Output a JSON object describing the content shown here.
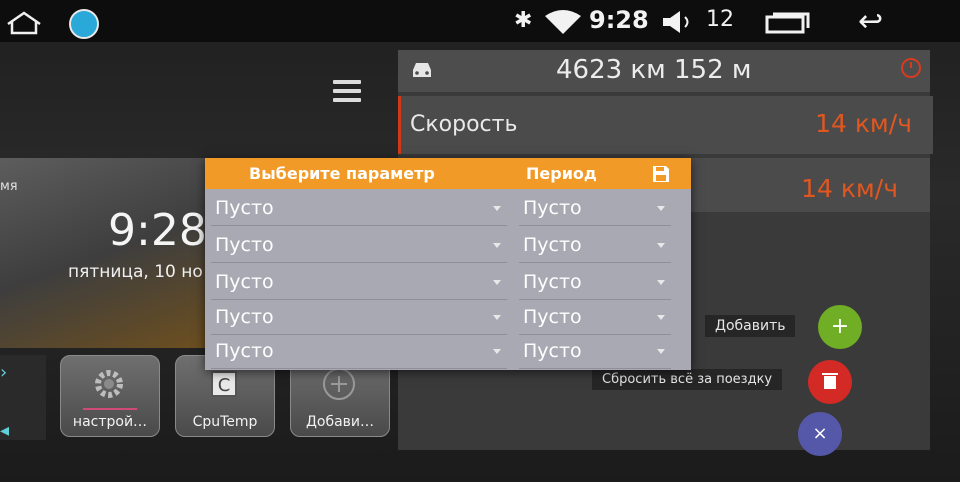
{
  "status_bar": {
    "time": "9:28",
    "volume": "12",
    "icons": [
      "home-icon",
      "app-icon",
      "bluetooth-icon",
      "wifi-icon",
      "volume-icon",
      "recent-apps-icon",
      "back-icon"
    ]
  },
  "clock_widget": {
    "label": "мя",
    "time": "9:28",
    "date": "пятница, 10 но"
  },
  "apps": [
    {
      "label": "настрой…",
      "icon": "gear-icon"
    },
    {
      "label": "CpuTemp",
      "icon": "cpu-icon"
    },
    {
      "label": "Добави…",
      "icon": "plus-icon"
    }
  ],
  "trip": {
    "distance": "4623 км 152 м",
    "speed_label": "Скорость",
    "speed_value": "14 км/ч",
    "speed_value_2": "14 км/ч",
    "add_label": "Добавить",
    "reset_label": "Сбросить всё за поездку",
    "add_button": "+",
    "close_button": "×"
  },
  "dialog": {
    "title": "Выберите параметр",
    "period_header": "Период",
    "rows": [
      {
        "param": "Пусто",
        "period": "Пусто"
      },
      {
        "param": "Пусто",
        "period": "Пусто"
      },
      {
        "param": "Пусто",
        "period": "Пусто"
      },
      {
        "param": "Пусто",
        "period": "Пусто"
      },
      {
        "param": "Пусто",
        "period": "Пусто"
      }
    ]
  },
  "colors": {
    "accent": "#f19a27",
    "speed": "#e2561f",
    "add": "#6fae25",
    "delete": "#d42a26",
    "close": "#5558a8"
  }
}
